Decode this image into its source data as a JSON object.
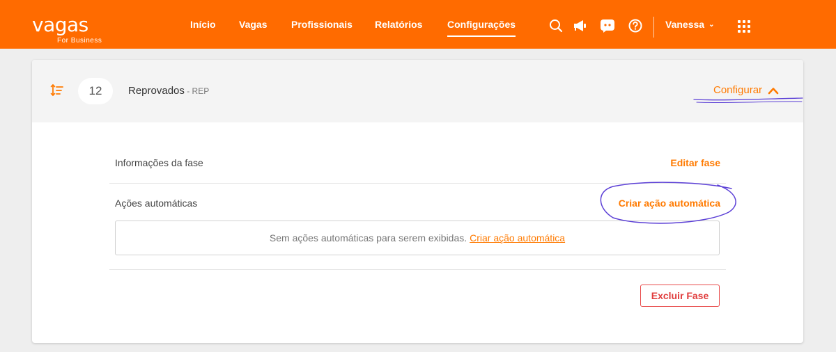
{
  "brand": {
    "name": "vagas",
    "subtitle": "For Business",
    "accent": "#ff6b00"
  },
  "nav": [
    {
      "label": "Início",
      "active": false
    },
    {
      "label": "Vagas",
      "active": false
    },
    {
      "label": "Profissionais",
      "active": false
    },
    {
      "label": "Relatórios",
      "active": false
    },
    {
      "label": "Configurações",
      "active": true
    }
  ],
  "header_icons": [
    "search-icon",
    "megaphone-icon",
    "chat-icon",
    "help-icon"
  ],
  "user": {
    "name": "Vanessa",
    "caret": "⌄"
  },
  "phase": {
    "count": "12",
    "name": "Reprovados",
    "code": " - REP",
    "configure_label": "Configurar"
  },
  "sections": {
    "info_title": "Informações da fase",
    "edit_label": "Editar fase",
    "actions_title": "Ações automáticas",
    "create_label": "Criar ação automática"
  },
  "empty_state": {
    "text": "Sem ações automáticas para serem exibidas.",
    "link": "Criar ação automática"
  },
  "delete_label": "Excluir Fase"
}
